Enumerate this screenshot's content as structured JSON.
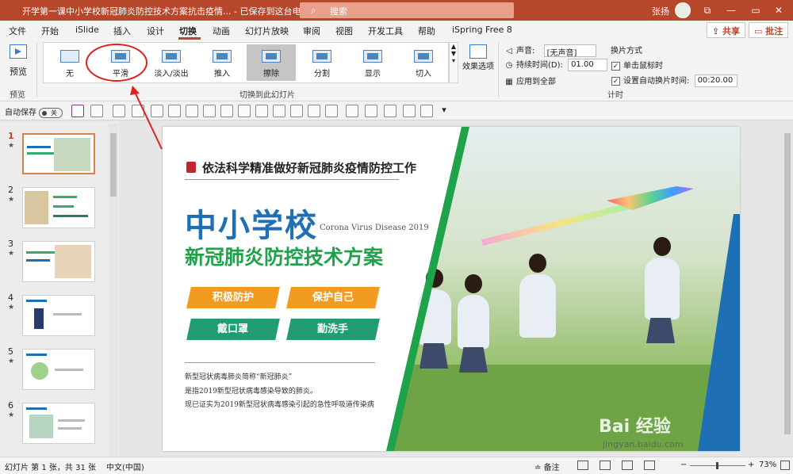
{
  "window": {
    "title": "开学第一课中小学校新冠肺炎防控技术方案抗击疫情... - 已保存到这台电脑",
    "search_placeholder": "搜索",
    "user": "张扬",
    "controls": [
      "—",
      "⧉",
      "▭",
      "✕"
    ]
  },
  "tabs": {
    "items": [
      "文件",
      "开始",
      "iSlide",
      "插入",
      "设计",
      "切换",
      "动画",
      "幻灯片放映",
      "审阅",
      "视图",
      "开发工具",
      "帮助",
      "iSpring Free 8"
    ],
    "active": "切换",
    "share": "共享",
    "comments": "批注"
  },
  "ribbon": {
    "preview_label": "预览",
    "preview_group": "预览",
    "transitions": [
      "无",
      "平滑",
      "淡入/淡出",
      "推入",
      "擦除",
      "分割",
      "显示",
      "切入"
    ],
    "selected_transition": "擦除",
    "transitions_group": "切换到此幻灯片",
    "effect_options": "效果选项",
    "sound_label": "声音:",
    "sound_value": "[无声音]",
    "duration_label": "持续时间(D):",
    "duration_value": "01.00",
    "apply_all": "应用到全部",
    "advance_title": "换片方式",
    "on_click": "单击鼠标时",
    "auto_after": "设置自动换片时间:",
    "auto_after_value": "00:20.00",
    "timing_group": "计时"
  },
  "qat": {
    "autosave": "自动保存",
    "toggle": "关"
  },
  "slides": {
    "numbers": [
      "1",
      "2",
      "3",
      "4",
      "5",
      "6"
    ],
    "active": "1"
  },
  "slide": {
    "header": "依法科学精准做好新冠肺炎疫情防控工作",
    "title": "中小学校",
    "english": "Corona Virus Disease 2019",
    "subtitle": "新冠肺炎防控技术方案",
    "pills": [
      "积极防护",
      "保护自己",
      "戴口罩",
      "勤洗手"
    ],
    "desc": [
      "新型冠状病毒肺炎简称“新冠肺炎”",
      "是指2019新型冠状病毒感染导致的肺炎。",
      "现已证实为2019新型冠状病毒感染引起的急性呼吸道传染病"
    ]
  },
  "status": {
    "slide_info": "幻灯片 第 1 张，共 31 张",
    "language": "中文(中国)",
    "notes": "备注",
    "zoom": "73%"
  },
  "watermark": {
    "brand": "Bai 经验",
    "url": "jingyan.baidu.com"
  },
  "colors": {
    "accent": "#b7472a",
    "slide_blue": "#1f6fb5",
    "slide_green": "#1ea24a",
    "pill_orange": "#f29c1f",
    "pill_teal": "#219c73",
    "annotation": "#e02020"
  }
}
